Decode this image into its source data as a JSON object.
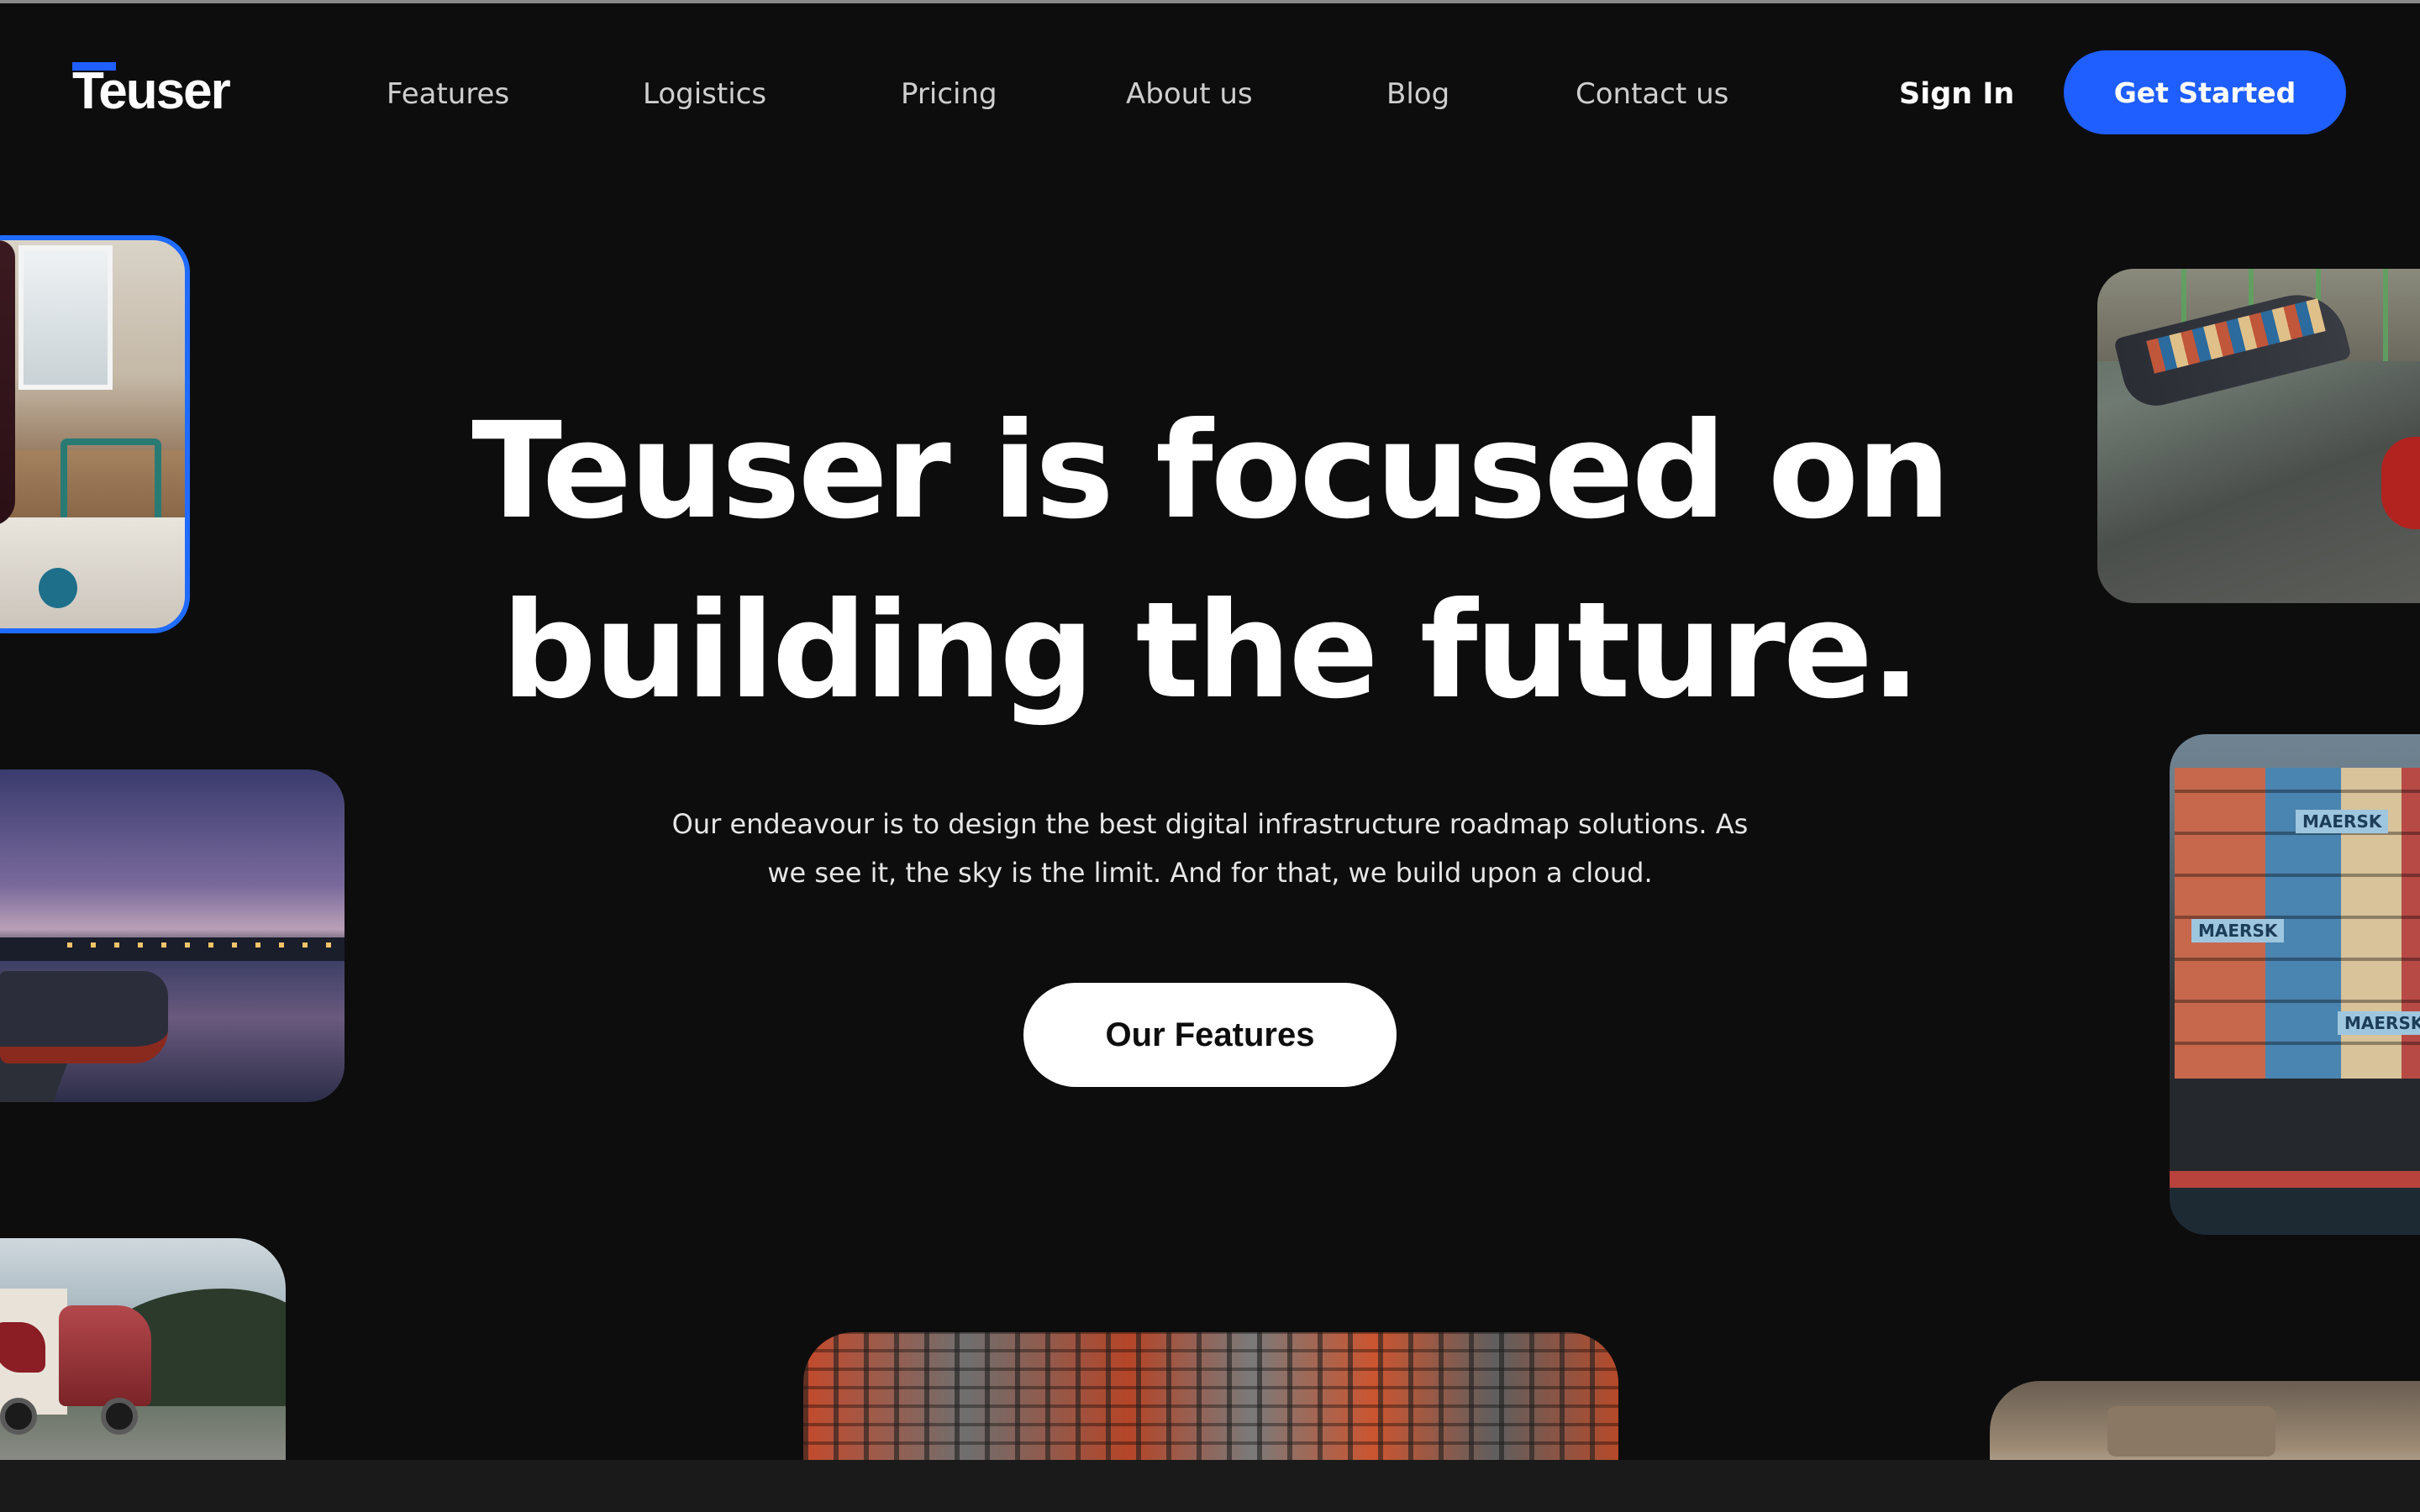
{
  "brand": {
    "name": "Teuser",
    "accent": "#1f5eff"
  },
  "nav": {
    "items": [
      {
        "label": "Features"
      },
      {
        "label": "Logistics"
      },
      {
        "label": "Pricing"
      },
      {
        "label": "About us"
      },
      {
        "label": "Blog"
      },
      {
        "label": "Contact us"
      }
    ],
    "signin_label": "Sign In",
    "cta_label": "Get Started"
  },
  "hero": {
    "title_line1": "Teuser is focused on",
    "title_line2": "building the future.",
    "subtitle_line1": "Our endeavour is to design the best digital infrastructure roadmap solutions. As",
    "subtitle_line2": "we see it, the sky is the limit. And for that, we build upon a cloud.",
    "button_label": "Our Features"
  },
  "photos": {
    "container_label": "MAERSK"
  }
}
